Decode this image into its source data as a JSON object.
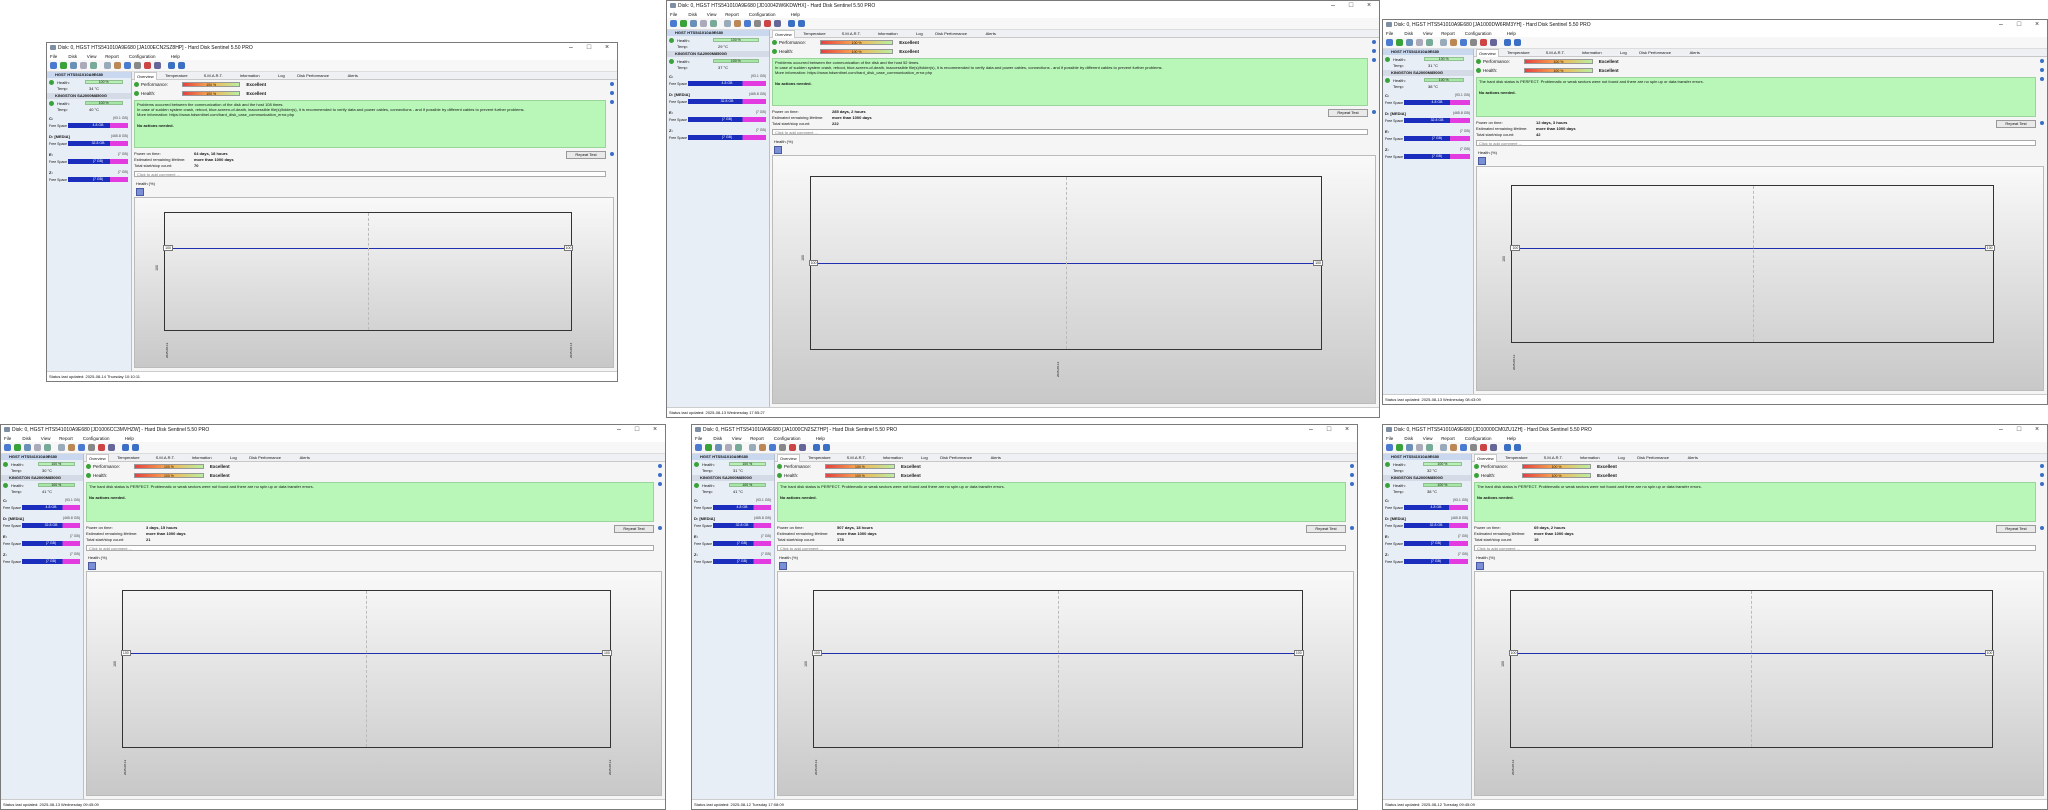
{
  "menu_items": [
    "File",
    "Disk",
    "View",
    "Report",
    "Configuration",
    "Help"
  ],
  "tabs": [
    "Overview",
    "Temperature",
    "S.M.A.R.T.",
    "Information",
    "Log",
    "Disk Performance",
    "Alerts"
  ],
  "labels": {
    "performance": "Performance:",
    "health": "Health:",
    "excellent": "Excellent",
    "health_short": "Health:",
    "temp": "Temp:",
    "free_space": "Free Space",
    "power_on": "Power on time:",
    "remaining": "Estimated remaining lifetime:",
    "startstop": "Total start/stop count:",
    "repeat": "Repeat Test",
    "comment": "Click to add comment ...",
    "health_pct": "Health (%)",
    "no_actions": "No actions needed.",
    "pct100": "100 %",
    "disk1": "HGST HTS541010A9E680",
    "disk2": "KINGSTON SA2000M8500G",
    "lifetime": "more than 1000 days"
  },
  "windows": [
    {
      "title": "Disk: 0, HGST HTS541010A9E680 [JA100ECN2SZ8HP] - Hard Disk Sentinel 5.50 PRO",
      "status": "Status last updated: 2025-08-14 Thursday 10:10:11",
      "power_on": "64 days, 18 hours",
      "startstop": "70",
      "temp1": "34 °C",
      "temp2": "40 °C",
      "msg": "Problems occurred between the communication of the disk and the host 108 times.\nIn case of sudden system crash, reboot, blue-screen-of-death, inaccessible file(s)/folder(s), it is recommended to verify data and power cables, connections - and if possible try different cables to prevent further problems.\nMore information: https://www.hdsentinel.com/hard_disk_case_communication_error.php",
      "chart_value": "100",
      "chart_date": "2025-08-13",
      "chart_date2": "2025-08-14"
    },
    {
      "title": "Disk: 0, HGST HTS541010A9E680 [JD10042W6KDWHX] - Hard Disk Sentinel 5.50 PRO",
      "status": "Status last updated: 2025-08-13 Wednesday 17:55:27",
      "power_on": "285 days, 2 hours",
      "startstop": "222",
      "temp1": "29 °C",
      "temp2": "37 °C",
      "msg": "Problems occurred between the communication of the disk and the host 52 times.\nIn case of sudden system crash, reboot, blue-screen-of-death, inaccessible file(s)/folder(s), it is recommended to verify data and power cables, connections - and if possible try different cables to prevent further problems.\nMore information: https://www.hdsentinel.com/hard_disk_case_communication_error.php",
      "chart_value": "100",
      "chart_date": "2025-08-13",
      "chart_date2": ""
    },
    {
      "title": "Disk: 0, HGST HTS541010A9E680 [JA1000DW6RM3YH] - Hard Disk Sentinel 5.50 PRO",
      "status": "Status last updated: 2025-08-13 Wednesday 08:43:09",
      "power_on": "12 days, 3 hours",
      "startstop": "42",
      "temp1": "31 °C",
      "temp2": "38 °C",
      "msg": "The hard disk status is PERFECT. Problematic or weak sectors were not found and there are no spin up or data transfer errors.",
      "chart_value": "100",
      "chart_date": "2025-08-13",
      "chart_date2": ""
    },
    {
      "title": "Disk: 0, HGST HTS541010A9E680 [JD1006CC3MVHZW] - Hard Disk Sentinel 5.50 PRO",
      "status": "Status last updated: 2025-08-13 Wednesday 09:45:09",
      "power_on": "3 days, 15 hours",
      "startstop": "21",
      "temp1": "30 °C",
      "temp2": "41 °C",
      "msg": "The hard disk status is PERFECT. Problematic or weak sectors were not found and there are no spin up or data transfer errors.",
      "chart_value": "100",
      "chart_date": "2025-08-12",
      "chart_date2": "2025-08-13"
    },
    {
      "title": "Disk: 0, HGST HTS541010A9E680 [JA1000CN2SZ7HP] - Hard Disk Sentinel 5.50 PRO",
      "status": "Status last updated: 2025-08-12 Tuesday 17:08:09",
      "power_on": "507 days, 18 hours",
      "startstop": "178",
      "temp1": "31 °C",
      "temp2": "41 °C",
      "msg": "The hard disk status is PERFECT. Problematic or weak sectors were not found and there are no spin up or data transfer errors.",
      "chart_value": "100",
      "chart_date": "2025-08-12",
      "chart_date2": ""
    },
    {
      "title": "Disk: 0, HGST HTS541010A9E680 [JD10000CM0ZU1ZH] - Hard Disk Sentinel 5.50 PRO",
      "status": "Status last updated: 2025-08-12 Tuesday 09:45:09",
      "power_on": "69 days, 2 hours",
      "startstop": "19",
      "temp1": "32 °C",
      "temp2": "38 °C",
      "msg": "The hard disk status is PERFECT. Problematic or weak sectors were not found and there are no spin up or data transfer errors.",
      "chart_value": "100",
      "chart_date": "2025-08-12",
      "chart_date2": ""
    }
  ],
  "volumes": [
    {
      "name": "C:",
      "size": "(93.1 GB)",
      "free": "4.8 GB"
    },
    {
      "name": "D: [MEDIA]",
      "size": "(465.8 GB)",
      "free": "32.8 GB"
    },
    {
      "name": "E:",
      "size": "(7 GB)",
      "free": "(7 GB)"
    },
    {
      "name": "Z:",
      "size": "(7 GB)",
      "free": "(7 GB)"
    }
  ],
  "colors": {
    "health_green": "#3aa23a",
    "message_bg": "#b8f7b8",
    "graph_line": "#1f2fb0"
  }
}
